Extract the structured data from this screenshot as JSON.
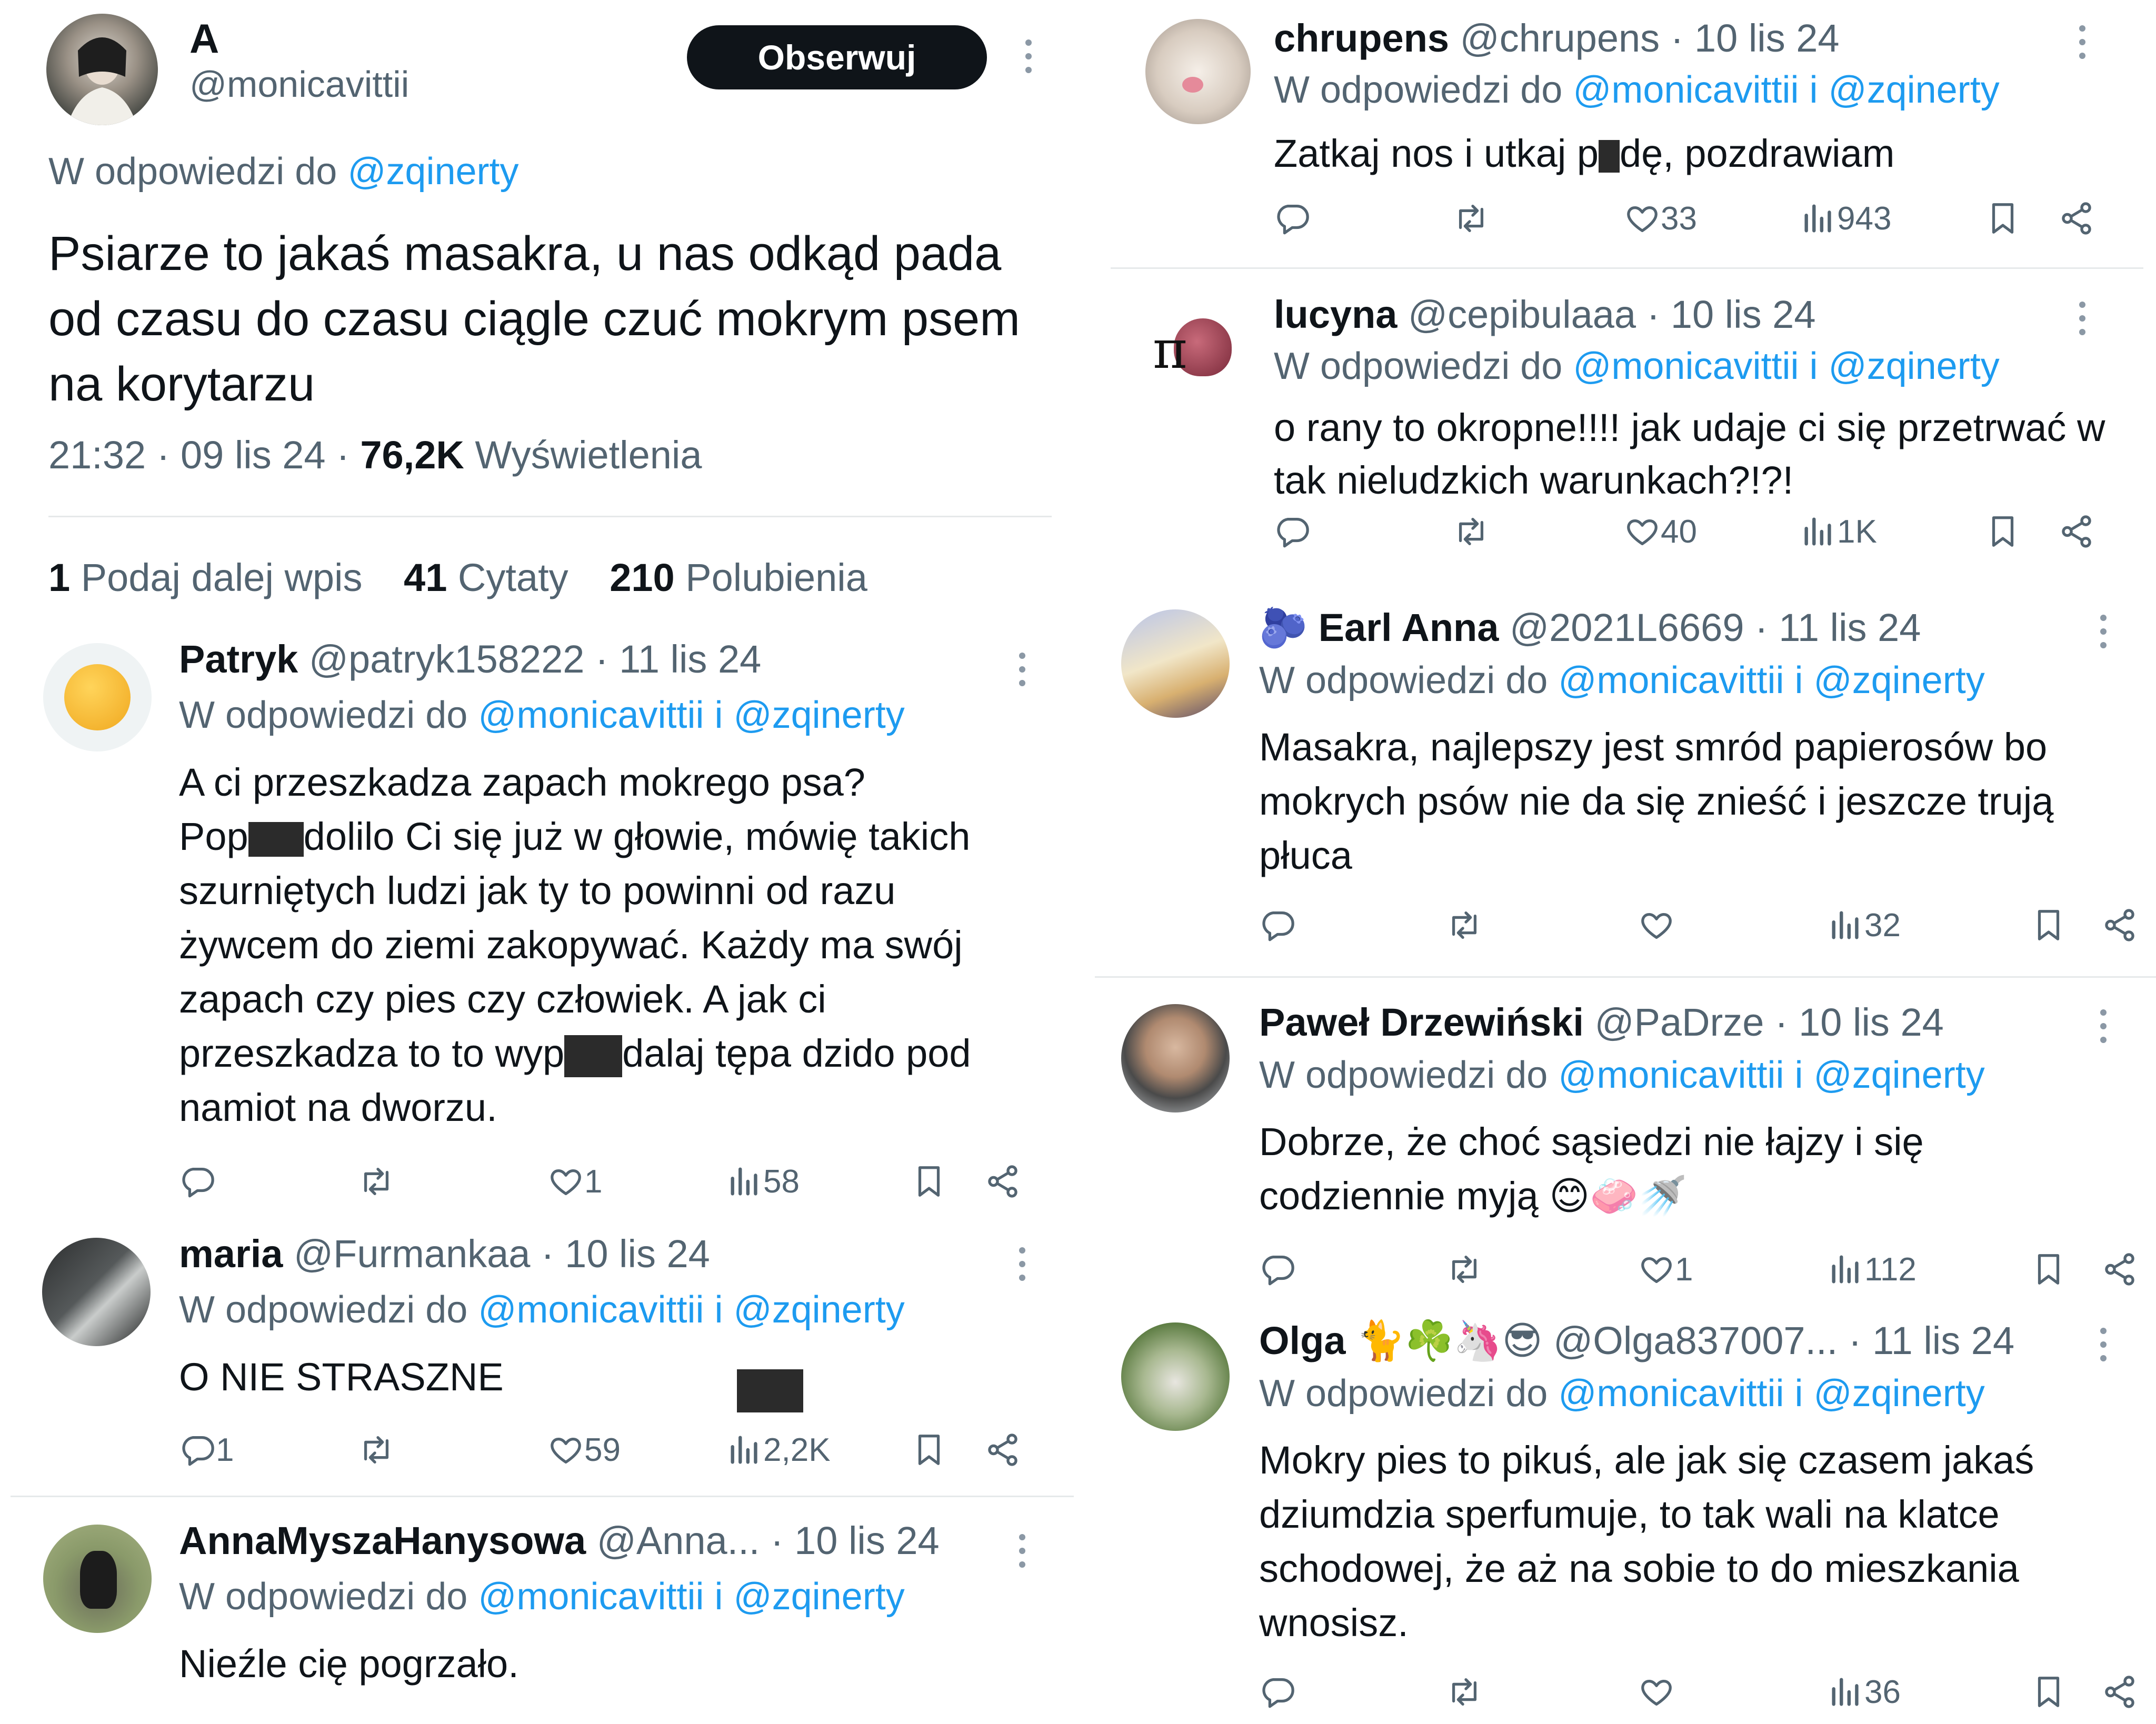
{
  "main_tweet": {
    "name": "A",
    "handle": "@monicavittii",
    "follow_label": "Obserwuj",
    "reply_prefix": "W odpowiedzi do",
    "reply_to": "@zqinerty",
    "text": "Psiarze to jakaś masakra, u nas odkąd pada od czasu do czasu ciągle czuć mokrym psem na korytarzu",
    "time": "21:32",
    "date": "09 lis 24",
    "views_count": "76,2K",
    "views_label": "Wyświetlenia",
    "stats": [
      {
        "count": "1",
        "label": "Podaj dalej wpis"
      },
      {
        "count": "41",
        "label": "Cytaty"
      },
      {
        "count": "210",
        "label": "Polubienia"
      }
    ]
  },
  "reply_prefix": "W odpowiedzi do",
  "reply_mentions": "@monicavittii i @zqinerty",
  "replies_left": [
    {
      "name": "Patryk",
      "handle": "@patryk158222",
      "date": "· 11 lis 24",
      "text_parts": [
        "A ci przeszkadza zapach mokrego psa?",
        "Pop",
        "dolilo Ci się już w głowie, mówię takich szurniętych ludzi jak ty to powinni od razu żywcem do ziemi zakopywać. Każdy ma swój zapach czy pies czy człowiek. A jak ci przeszkadza to to wyp",
        "dalaj tępa dzido pod namiot na dworzu."
      ],
      "replies": "",
      "likes": "1",
      "views": "58"
    },
    {
      "name": "maria",
      "handle": "@Furmankaa",
      "date": "· 10 lis 24",
      "text": "O NIE STRASZNE",
      "replies": "1",
      "likes": "59",
      "views": "2,2K"
    },
    {
      "name": "AnnaMyszaHanysowa",
      "handle": "@Anna...",
      "date": "· 10 lis 24",
      "text": "Nieźle cię pogrzało."
    }
  ],
  "replies_right": [
    {
      "name": "chrupens",
      "handle": "@chrupens",
      "date": "· 10 lis 24",
      "text_parts": [
        "Zatkaj nos i utkaj p",
        "dę, pozdrawiam"
      ],
      "likes": "33",
      "views": "943"
    },
    {
      "name": "lucyna",
      "handle": "@cepibulaaa",
      "date": "· 10 lis 24",
      "text": "o rany to okropne!!!! jak udaje ci się przetrwać w tak nieludzkich warunkach?!?!",
      "likes": "40",
      "views": "1K"
    },
    {
      "name": "Earl Anna",
      "name_emoji": "🫐",
      "handle": "@2021L6669",
      "date": "· 11 lis 24",
      "text": "Masakra, najlepszy jest smród papierosów bo mokrych psów nie da się znieść i jeszcze trują płuca",
      "likes": "",
      "views": "32"
    },
    {
      "name": "Paweł Drzewiński",
      "handle": "@PaDrze",
      "date": "· 10 lis 24",
      "text": "Dobrze, że choć sąsiedzi nie łajzy i się codziennie myją 😊🧼🚿",
      "likes": "1",
      "views": "112"
    },
    {
      "name": "Olga",
      "name_emoji": "🐈☘️🦄😎",
      "handle": "@Olga837007...",
      "date": "· 11 lis 24",
      "text": "Mokry pies to pikuś, ale jak się czasem jakaś dziumdzia sperfumuje, to tak wali na klatce schodowej, że aż na sobie to do mieszkania wnosisz.",
      "likes": "",
      "views": "36"
    }
  ],
  "colors": {
    "link": "#1d9bf0",
    "secondary": "#536471",
    "text": "#0f1419",
    "divider": "#e6e9ea"
  },
  "icons": [
    "reply-icon",
    "retweet-icon",
    "like-icon",
    "views-icon",
    "bookmark-icon",
    "share-icon",
    "more-icon"
  ]
}
